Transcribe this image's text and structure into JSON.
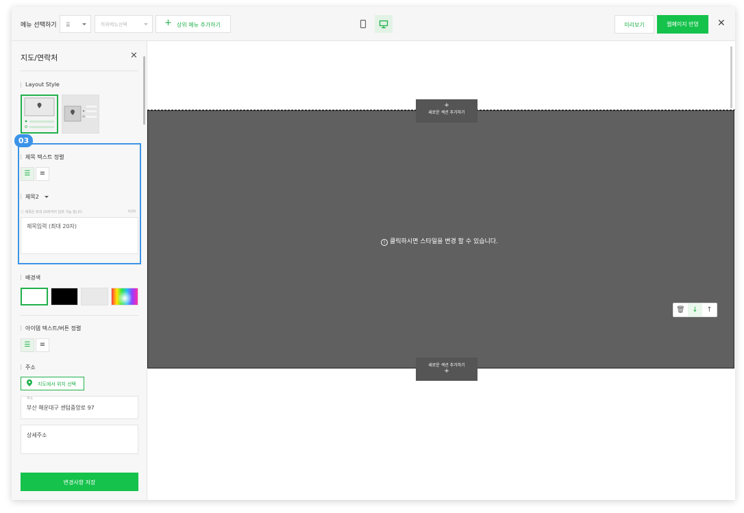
{
  "topbar": {
    "menu_select_label": "메뉴 선택하기",
    "top_menu_value": "홈",
    "sub_menu_placeholder": "하위메뉴선택",
    "add_menu_label": "상위 메뉴 추가하기",
    "preview_label": "미리보기",
    "publish_label": "웹페이지 반영",
    "active_device": "desktop"
  },
  "sidebar": {
    "title": "지도/연락처",
    "layout_style_label": "Layout Style",
    "badge": "03",
    "title_align_label": "제목 텍스트 정렬",
    "heading_select": "제목2",
    "hint": "제목은 최대 20자까지 입력 가능 합니다.",
    "counter": "0/20",
    "title_placeholder": "제목입력 (최대 20자)",
    "bg_color_label": "배경색",
    "item_align_label": "아이템 텍스트/버튼 정렬",
    "address_label": "주소",
    "map_location_button": "지도에서 위치 선택",
    "address_field_label": "주소",
    "address_value": "부산 해운대구 센텀중앙로 97",
    "detail_address_placeholder": "상세주소",
    "save_button": "변경사항 저장"
  },
  "canvas": {
    "add_section_label": "새로운 섹션 추가하기",
    "center_message": "클릭하시면 스타일을 변경 할 수 있습니다."
  },
  "colors": {
    "brand_green": "#15c24b",
    "highlight_blue": "#3b93e8",
    "section_bg": "#606060"
  }
}
